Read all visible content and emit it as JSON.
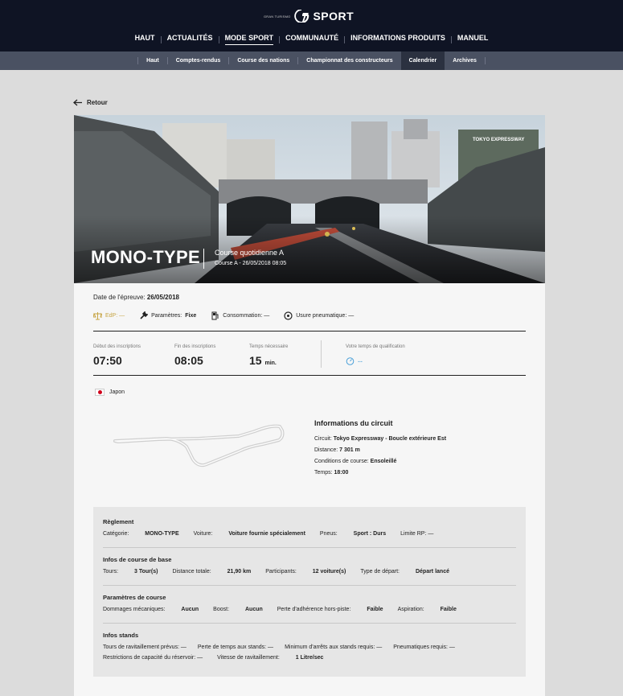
{
  "header": {
    "logo_small": "GRAN TURISMO",
    "logo_text": "SPORT",
    "nav": [
      "HAUT",
      "ACTUALITÉS",
      "MODE SPORT",
      "COMMUNAUTÉ",
      "INFORMATIONS PRODUITS",
      "MANUEL"
    ],
    "nav_active": "MODE SPORT",
    "subnav": [
      "Haut",
      "Comptes-rendus",
      "Course des nations",
      "Championnat des constructeurs",
      "Calendrier",
      "Archives"
    ],
    "subnav_active": "Calendrier"
  },
  "back_label": "Retour",
  "hero": {
    "title": "MONO-TYPE",
    "subtitle": "Course quotidienne A",
    "subline": "Course A - 26/05/2018 08:05",
    "sign": "TOKYO EXPRESSWAY"
  },
  "event": {
    "date_label": "Date de l'épreuve:",
    "date_value": "26/05/2018",
    "edp_label": "EdP: —",
    "params_label": "Paramètres:",
    "params_value": "Fixe",
    "consumption": "Consommation: —",
    "tyre_wear": "Usure pneumatique: —"
  },
  "times": {
    "start_label": "Début des inscriptions",
    "start_value": "07:50",
    "end_label": "Fin des inscriptions",
    "end_value": "08:05",
    "req_label": "Temps nécessaire",
    "req_value": "15",
    "req_unit": "min.",
    "qual_label": "Votre temps de qualification",
    "qual_value": "--"
  },
  "country": "Japon",
  "circuit": {
    "title": "Informations du circuit",
    "circuit_label": "Circuit:",
    "circuit_value": "Tokyo Expressway - Boucle extérieure Est",
    "distance_label": "Distance:",
    "distance_value": "7 301 m",
    "cond_label": "Conditions de course:",
    "cond_value": "Ensoleillé",
    "time_label": "Temps:",
    "time_value": "18:00"
  },
  "rules": {
    "reglement": {
      "title": "Règlement",
      "cat_label": "Catégorie:",
      "cat_value": "MONO-TYPE",
      "car_label": "Voiture:",
      "car_value": "Voiture fournie spécialement",
      "tyre_label": "Pneus:",
      "tyre_value": "Sport : Durs",
      "rp_label": "Limite RP: —"
    },
    "base": {
      "title": "Infos de course de base",
      "laps_label": "Tours:",
      "laps_value": "3 Tour(s)",
      "dist_label": "Distance totale:",
      "dist_value": "21,90 km",
      "part_label": "Participants:",
      "part_value": "12 voiture(s)",
      "start_label": "Type de départ:",
      "start_value": "Départ lancé"
    },
    "params": {
      "title": "Paramètres de course",
      "dmg_label": "Dommages mécaniques:",
      "dmg_value": "Aucun",
      "boost_label": "Boost:",
      "boost_value": "Aucun",
      "grip_label": "Perte d'adhérence hors-piste:",
      "grip_value": "Faible",
      "asp_label": "Aspiration:",
      "asp_value": "Faible"
    },
    "pits": {
      "title": "Infos stands",
      "refuel_laps": "Tours de ravitaillement prévus: —",
      "time_loss": "Perte de temps aux stands: —",
      "min_stops": "Minimum d'arrêts aux stands requis: —",
      "tyres_req": "Pneumatiques requis: —",
      "tank": "Restrictions de capacité du réservoir: —",
      "speed_label": "Vitesse de ravitaillement:",
      "speed_value": "1 Litre/sec"
    }
  }
}
